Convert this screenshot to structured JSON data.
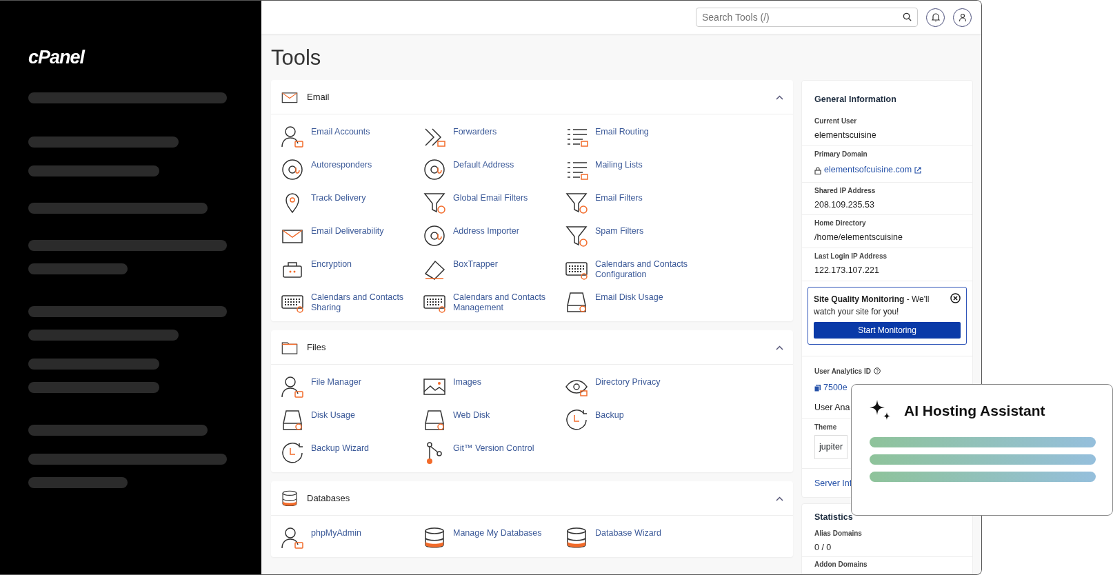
{
  "logo": "cPanel",
  "header": {
    "search": {
      "placeholder": "Search Tools (/)"
    }
  },
  "page_title": "Tools",
  "sections": [
    {
      "title": "Email",
      "expanded": true,
      "tools": [
        {
          "label": "Email Accounts"
        },
        {
          "label": "Forwarders"
        },
        {
          "label": "Email Routing"
        },
        {
          "label": "Autoresponders"
        },
        {
          "label": "Default Address"
        },
        {
          "label": "Mailing Lists"
        },
        {
          "label": "Track Delivery"
        },
        {
          "label": "Global Email Filters"
        },
        {
          "label": "Email Filters"
        },
        {
          "label": "Email Deliverability"
        },
        {
          "label": "Address Importer"
        },
        {
          "label": "Spam Filters"
        },
        {
          "label": "Encryption"
        },
        {
          "label": "BoxTrapper"
        },
        {
          "label": "Calendars and Contacts Configuration"
        },
        {
          "label": "Calendars and Contacts Sharing"
        },
        {
          "label": "Calendars and Contacts Management"
        },
        {
          "label": "Email Disk Usage"
        }
      ]
    },
    {
      "title": "Files",
      "expanded": true,
      "tools": [
        {
          "label": "File Manager"
        },
        {
          "label": "Images"
        },
        {
          "label": "Directory Privacy"
        },
        {
          "label": "Disk Usage"
        },
        {
          "label": "Web Disk"
        },
        {
          "label": "Backup"
        },
        {
          "label": "Backup Wizard"
        },
        {
          "label": "Git™ Version Control"
        }
      ]
    },
    {
      "title": "Databases",
      "expanded": true,
      "tools": [
        {
          "label": "phpMyAdmin"
        },
        {
          "label": "Manage My Databases"
        },
        {
          "label": "Database Wizard"
        }
      ]
    }
  ],
  "general_information": {
    "title": "General Information",
    "fields": [
      {
        "label": "Current User",
        "value": "elementscuisine"
      },
      {
        "label": "Primary Domain",
        "value": "elementsofcuisine.com",
        "kind": "link"
      },
      {
        "label": "Shared IP Address",
        "value": "208.109.235.53"
      },
      {
        "label": "Home Directory",
        "value": "/home/elementscuisine"
      },
      {
        "label": "Last Login IP Address",
        "value": "122.173.107.221"
      }
    ],
    "promo": {
      "title": "Site Quality Monitoring",
      "text": " - We'll watch your site for you!",
      "button": "Start Monitoring"
    },
    "analytics": {
      "label": "User Analytics ID",
      "id": "7500e",
      "status": "User Ana"
    },
    "theme": {
      "label": "Theme",
      "value": "jupiter"
    },
    "server_link": "Server Inf"
  },
  "statistics": {
    "title": "Statistics",
    "fields": [
      {
        "label": "Alias Domains",
        "value": "0 / 0"
      },
      {
        "label": "Addon Domains"
      }
    ]
  },
  "assistant": {
    "title": "AI Hosting Assistant"
  }
}
